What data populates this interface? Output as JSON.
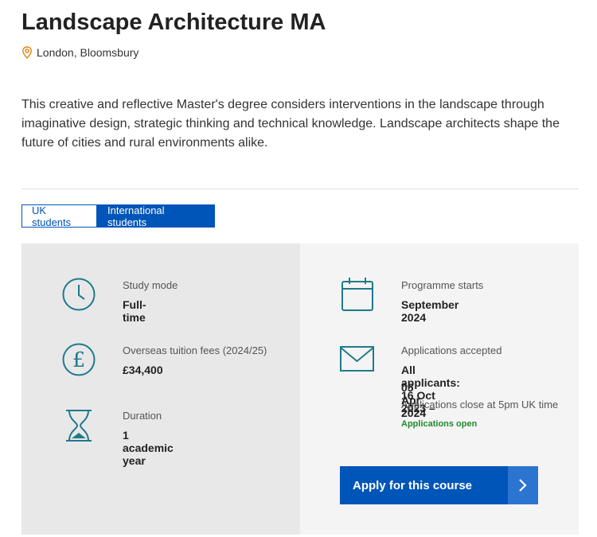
{
  "course": {
    "title": "Landscape Architecture MA",
    "location": "London, Bloomsbury",
    "intro": "This creative and reflective Master's degree considers interventions in the landscape through imaginative design, strategic thinking and technical knowledge. Landscape architects shape the future of cities and rural environments alike."
  },
  "tabs": [
    {
      "label": "UK students",
      "selected": false
    },
    {
      "label": "International students",
      "selected": true
    }
  ],
  "details": {
    "study_mode": {
      "label": "Study mode",
      "value": "Full-time",
      "icon": "clock-icon"
    },
    "fees": {
      "label": "Overseas tuition fees (2024/25)",
      "value": "£34,400",
      "icon": "pound-icon"
    },
    "duration": {
      "label": "Duration",
      "value": "1 academic year",
      "icon": "hourglass-icon"
    },
    "starts": {
      "label": "Programme starts",
      "value": "September 2024",
      "icon": "calendar-icon"
    },
    "applications": {
      "label": "Applications accepted",
      "value_line1": "All applicants: 16 Oct 2023 –",
      "value_line2": "05 Apr 2024",
      "note": "Applications close at 5pm UK time",
      "status": "Applications open",
      "icon": "envelope-icon"
    }
  },
  "apply_button": {
    "label": "Apply for this course"
  },
  "colors": {
    "primary": "#0055b8",
    "icon_teal": "#1f7a8c",
    "status_green": "#1f8a2e",
    "pin_orange": "#e08a1e"
  }
}
